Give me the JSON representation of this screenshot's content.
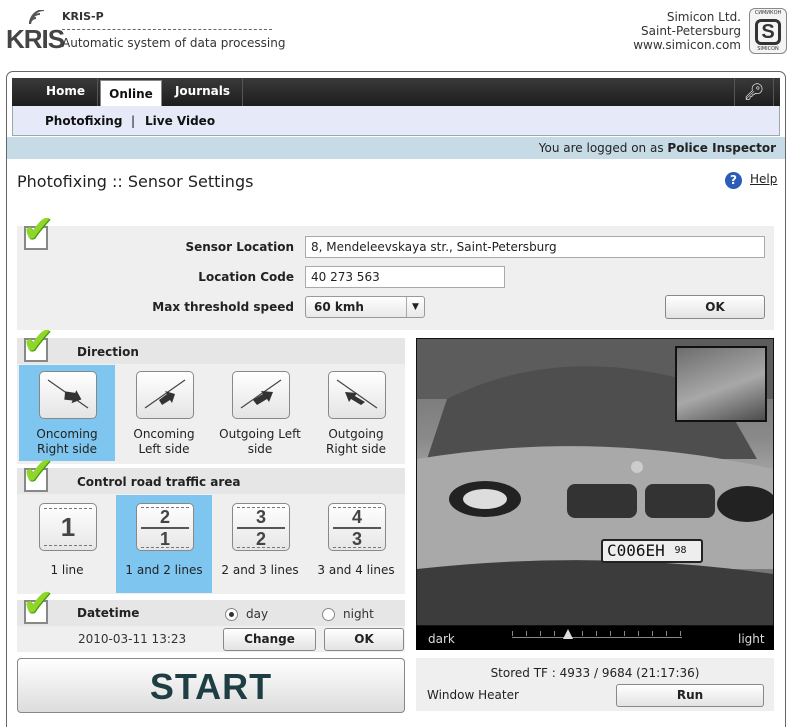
{
  "header": {
    "logo_text": "KRIS",
    "product_name": "KRIS-P",
    "product_description": "Automatic system of data processing",
    "company_lines": [
      "Simicon Ltd.",
      "Saint-Petersburg",
      "www.simicon.com"
    ],
    "company_logo_top": "СИМИКОН",
    "company_logo_bottom": "SIMICON"
  },
  "nav": {
    "tabs": [
      {
        "label": "Home",
        "active": false
      },
      {
        "label": "Online",
        "active": true
      },
      {
        "label": "Journals",
        "active": false
      }
    ],
    "key_icon": "key-icon"
  },
  "subnav": {
    "items": [
      "Photofixing",
      "Live Video"
    ],
    "separator": "|"
  },
  "login": {
    "prefix": "You are logged on as",
    "user": "Police Inspector"
  },
  "page": {
    "title": "Photofixing :: Sensor Settings",
    "help_label": "Help"
  },
  "sensor": {
    "location_label": "Sensor Location",
    "location_value": "8, Mendeleevskaya str., Saint-Petersburg",
    "code_label": "Location Code",
    "code_value": "40 273 563",
    "speed_label": "Max threshold speed",
    "speed_value": "60 kmh",
    "ok_label": "OK"
  },
  "direction": {
    "title": "Direction",
    "options": [
      {
        "label_1": "Oncoming",
        "label_2": "Right side",
        "selected": true
      },
      {
        "label_1": "Oncoming",
        "label_2": "Left side",
        "selected": false
      },
      {
        "label_1": "Outgoing Left",
        "label_2": "side",
        "selected": false
      },
      {
        "label_1": "Outgoing",
        "label_2": "Right side",
        "selected": false
      }
    ]
  },
  "traffic": {
    "title": "Control road traffic area",
    "options": [
      {
        "top": "1",
        "bottom": "",
        "label": "1 line",
        "selected": false
      },
      {
        "top": "2",
        "bottom": "1",
        "label": "1 and 2 lines",
        "selected": true
      },
      {
        "top": "3",
        "bottom": "2",
        "label": "2 and 3 lines",
        "selected": false
      },
      {
        "top": "4",
        "bottom": "3",
        "label": "3 and 4 lines",
        "selected": false
      }
    ]
  },
  "datetime": {
    "title": "Datetime",
    "value": "2010-03-11 13:23",
    "day_label": "day",
    "night_label": "night",
    "mode": "day",
    "change_label": "Change",
    "ok_label": "OK"
  },
  "camera": {
    "plate_text": "C006EH",
    "plate_region": "98",
    "dark_label": "dark",
    "light_label": "light",
    "brightness": 0.33
  },
  "start_label": "START",
  "status": {
    "stored_label": "Stored TF : 4933 / 9684 (21:17:36)",
    "heater_label": "Window Heater",
    "run_label": "Run"
  },
  "colors": {
    "selected": "#7ec6f0",
    "nav_dark": "#2a2a2a",
    "check_green": "#8fd62a",
    "login_bar": "#c6dbe6"
  }
}
